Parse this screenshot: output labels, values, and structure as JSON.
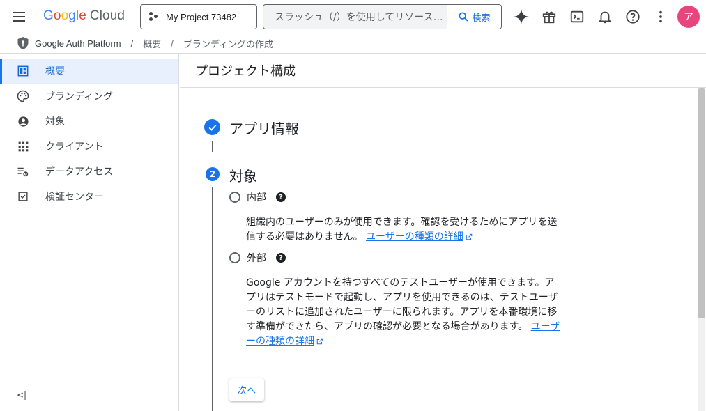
{
  "topbar": {
    "logo_google": "Google",
    "logo_cloud": "Cloud",
    "project_name": "My Project 73482",
    "search_placeholder": "スラッシュ（/）を使用してリソース…",
    "search_button": "検索",
    "avatar_letter": "ア",
    "avatar_color": "#e8457c"
  },
  "breadcrumb": {
    "items": [
      "Google Auth Platform",
      "概要",
      "ブランディングの作成"
    ],
    "separator": "/"
  },
  "sidebar": {
    "items": [
      {
        "label": "概要",
        "icon": "dashboard-icon",
        "active": true
      },
      {
        "label": "ブランディング",
        "icon": "palette-icon",
        "active": false
      },
      {
        "label": "対象",
        "icon": "account-circle-icon",
        "active": false
      },
      {
        "label": "クライアント",
        "icon": "apps-grid-icon",
        "active": false
      },
      {
        "label": "データアクセス",
        "icon": "data-settings-icon",
        "active": false
      },
      {
        "label": "検証センター",
        "icon": "checkbox-icon",
        "active": false
      }
    ],
    "collapse_label": "<|"
  },
  "main": {
    "title": "プロジェクト構成",
    "step1": {
      "title": "アプリ情報",
      "status": "complete"
    },
    "step2": {
      "number": "2",
      "title": "対象",
      "options": [
        {
          "label": "内部",
          "description": "組織内のユーザーのみが使用できます。確認を受けるためにアプリを送信する必要はありません。",
          "link": "ユーザーの種類の詳細"
        },
        {
          "label": "外部",
          "description": "Google アカウントを持つすべてのテストユーザーが使用できます。アプリはテストモードで起動し、アプリを使用できるのは、テストユーザーのリストに追加されたユーザーに限られます。アプリを本番環境に移す準備ができたら、アプリの確認が必要となる場合があります。",
          "link": "ユーザーの種類の詳細"
        }
      ],
      "next_button": "次へ"
    }
  },
  "colors": {
    "accent": "#1a73e8",
    "active_bg": "#e8f0fe"
  }
}
